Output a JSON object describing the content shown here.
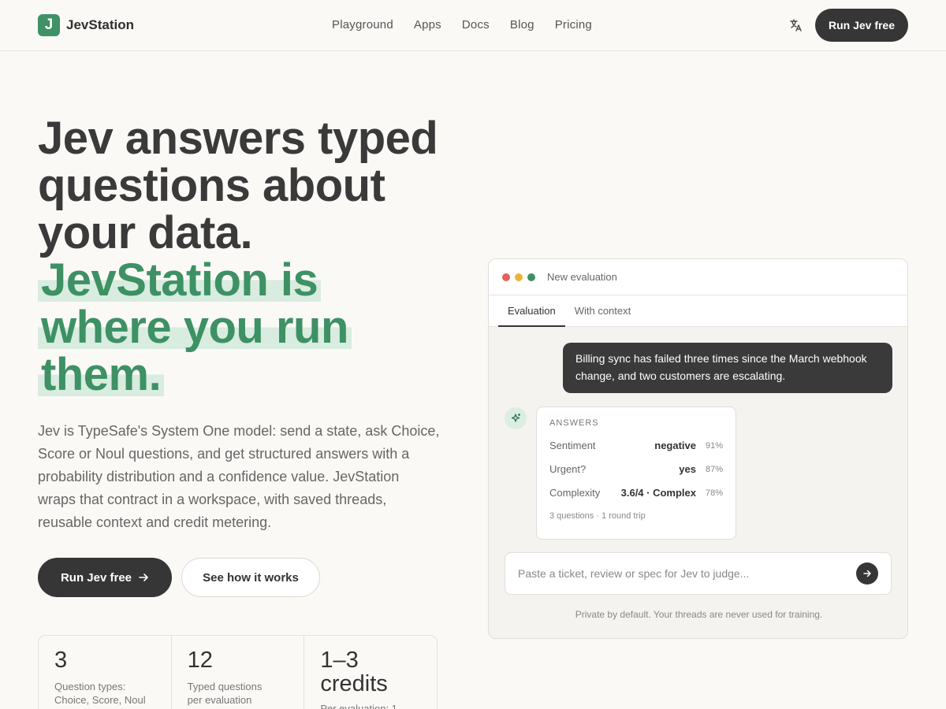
{
  "nav": {
    "logo_letter": "J",
    "brand": "JevStation",
    "links": [
      "Playground",
      "Apps",
      "Docs",
      "Blog",
      "Pricing"
    ],
    "cta": "Run Jev free"
  },
  "hero": {
    "title_line1": "Jev answers typed",
    "title_line2": "questions about",
    "title_line3": "your data.",
    "accent_line1": "JevStation is",
    "accent_line2": "where you run",
    "accent_line3": "them.",
    "body": "Jev is TypeSafe's System One model: send a state, ask Choice, Score or Noul questions, and get structured answers with a probability distribution and a confidence value. JevStation wraps that contract in a workspace, with saved threads, reusable context and credit metering.",
    "primary_button": "Run Jev free",
    "secondary_button": "See how it works"
  },
  "stats": [
    {
      "value": "3",
      "label_line1": "Question types:",
      "label_line2": "Choice, Score, Noul"
    },
    {
      "value": "12",
      "label_line1": "Typed questions",
      "label_line2": "per evaluation"
    },
    {
      "value": "1–3 credits",
      "label_line1": "Per evaluation: 1",
      "label_line2": ""
    }
  ],
  "panel": {
    "title": "New evaluation",
    "tabs": [
      "Evaluation",
      "With context"
    ],
    "message": "Billing sync has failed three times since the March webhook change, and two customers are escalating.",
    "answers_heading": "ANSWERS",
    "answers": [
      {
        "label": "Sentiment",
        "value": "negative",
        "pct": "91%"
      },
      {
        "label": "Urgent?",
        "value": "yes",
        "pct": "87%"
      },
      {
        "label": "Complexity",
        "value": "3.6/4 · Complex",
        "pct": "78%"
      }
    ],
    "answers_footer": "3 questions · 1 round trip",
    "input_placeholder": "Paste a ticket, review or spec for Jev to judge...",
    "footer": "Private by default. Your threads are never used for training."
  },
  "colors": {
    "accent": "#3d9164",
    "highlight": "#d8ece0",
    "dark_button": "#363636",
    "dot_red": "#e0625a",
    "dot_yellow": "#e9b43c",
    "dot_green": "#3d9164"
  }
}
